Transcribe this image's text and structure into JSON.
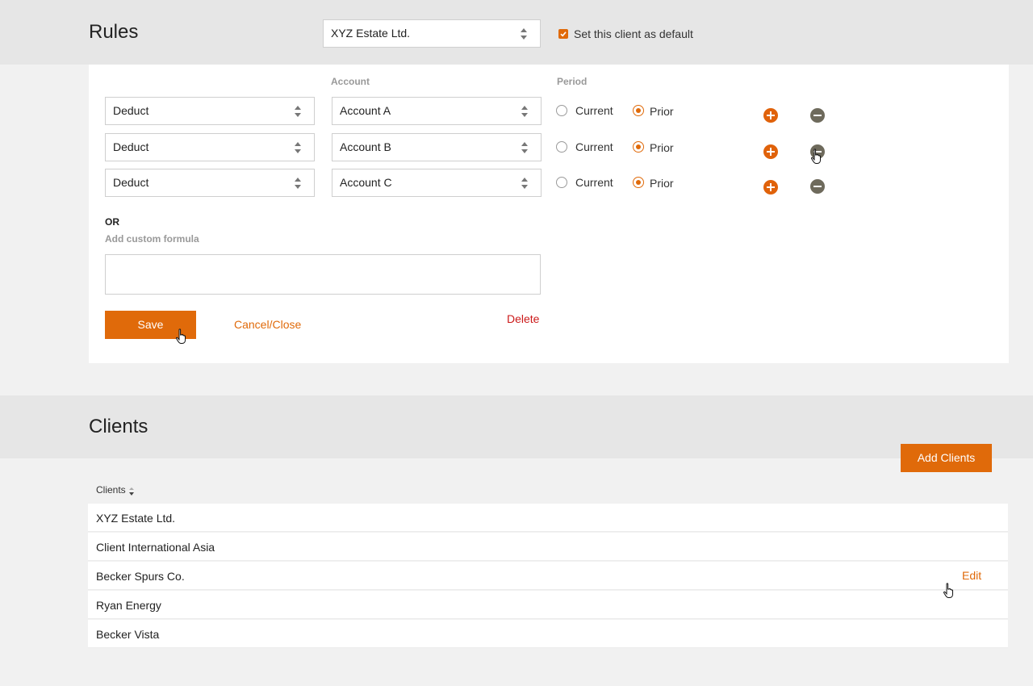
{
  "rules": {
    "title": "Rules",
    "client_select": "XYZ Estate Ltd.",
    "default_label": "Set this client as default",
    "default_checked": true,
    "columns": {
      "account": "Account",
      "period": "Period"
    },
    "rows": [
      {
        "action": "Deduct",
        "account": "Account A",
        "period_current": "Current",
        "period_prior": "Prior",
        "selected": "Prior"
      },
      {
        "action": "Deduct",
        "account": "Account B",
        "period_current": "Current",
        "period_prior": "Prior",
        "selected": "Prior"
      },
      {
        "action": "Deduct",
        "account": "Account C",
        "period_current": "Current",
        "period_prior": "Prior",
        "selected": "Prior"
      }
    ],
    "or_label": "OR",
    "custom_formula_label": "Add custom formula",
    "custom_formula_value": "",
    "save_label": "Save",
    "cancel_label": "Cancel/Close",
    "delete_label": "Delete"
  },
  "clients": {
    "title": "Clients",
    "add_button": "Add Clients",
    "column_header": "Clients",
    "rows": [
      {
        "name": "XYZ Estate Ltd."
      },
      {
        "name": "Client International Asia"
      },
      {
        "name": "Becker Spurs Co.",
        "action": "Edit"
      },
      {
        "name": "Ryan Energy"
      },
      {
        "name": "Becker Vista"
      }
    ]
  },
  "colors": {
    "accent": "#e06a0a",
    "danger": "#cc1a1a",
    "remove_button": "#6e6a5c"
  },
  "icons": [
    "select-arrows-icon",
    "checkbox-checked-icon",
    "radio-icon",
    "add-row-icon",
    "remove-row-icon",
    "sort-icon",
    "hand-cursor-icon"
  ]
}
